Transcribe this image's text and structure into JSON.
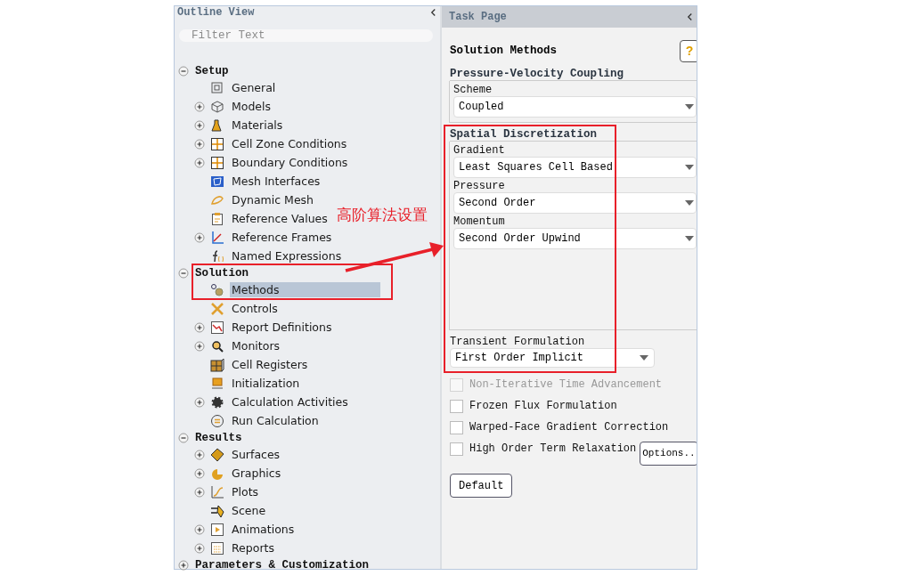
{
  "outline": {
    "title": "Outline View",
    "filter": {
      "placeholder": "Filter Text"
    },
    "sections": [
      {
        "label": "Setup",
        "expanded": true,
        "selected": false,
        "children": [
          {
            "label": "General",
            "kind": "leaf",
            "selected": false
          },
          {
            "label": "Models",
            "kind": "branch",
            "selected": false
          },
          {
            "label": "Materials",
            "kind": "branch",
            "selected": false
          },
          {
            "label": "Cell Zone Conditions",
            "kind": "branch",
            "selected": false
          },
          {
            "label": "Boundary Conditions",
            "kind": "branch",
            "selected": false
          },
          {
            "label": "Mesh Interfaces",
            "kind": "leaf",
            "selected": false
          },
          {
            "label": "Dynamic Mesh",
            "kind": "leaf",
            "selected": false
          },
          {
            "label": "Reference Values",
            "kind": "leaf",
            "selected": false
          },
          {
            "label": "Reference Frames",
            "kind": "branch",
            "selected": false
          },
          {
            "label": "Named Expressions",
            "kind": "leaf",
            "selected": false
          }
        ]
      },
      {
        "label": "Solution",
        "expanded": true,
        "selected": false,
        "children": [
          {
            "label": "Methods",
            "kind": "leaf",
            "selected": true
          },
          {
            "label": "Controls",
            "kind": "leaf",
            "selected": false
          },
          {
            "label": "Report Definitions",
            "kind": "branch",
            "selected": false
          },
          {
            "label": "Monitors",
            "kind": "branch",
            "selected": false
          },
          {
            "label": "Cell Registers",
            "kind": "leaf",
            "selected": false
          },
          {
            "label": "Initialization",
            "kind": "leaf",
            "selected": false
          },
          {
            "label": "Calculation Activities",
            "kind": "branch",
            "selected": false
          },
          {
            "label": "Run Calculation",
            "kind": "leaf",
            "selected": false
          }
        ]
      },
      {
        "label": "Results",
        "expanded": true,
        "selected": false,
        "children": [
          {
            "label": "Surfaces",
            "kind": "branch",
            "selected": false
          },
          {
            "label": "Graphics",
            "kind": "branch",
            "selected": false
          },
          {
            "label": "Plots",
            "kind": "branch",
            "selected": false
          },
          {
            "label": "Scene",
            "kind": "leaf",
            "selected": false
          },
          {
            "label": "Animations",
            "kind": "branch",
            "selected": false
          },
          {
            "label": "Reports",
            "kind": "branch",
            "selected": false
          }
        ]
      },
      {
        "label": "Parameters & Customization",
        "expanded": false,
        "selected": false
      }
    ]
  },
  "task_page": {
    "title": "Task Page",
    "heading": "Solution Methods",
    "help_button": "?",
    "coupling": {
      "title": "Pressure-Velocity Coupling",
      "fields": [
        {
          "label": "Scheme",
          "value": "Coupled"
        }
      ]
    },
    "spatial": {
      "title": "Spatial Discretization",
      "fields": [
        {
          "label": "Gradient",
          "value": "Least Squares Cell Based"
        },
        {
          "label": "Pressure",
          "value": "Second Order"
        },
        {
          "label": "Momentum",
          "value": "Second Order Upwind"
        }
      ]
    },
    "transient": {
      "label": "Transient Formulation",
      "value": "First Order Implicit"
    },
    "options": [
      {
        "label": "Non-Iterative Time Advancement",
        "checked": false,
        "disabled": true
      },
      {
        "label": "Frozen Flux Formulation",
        "checked": false,
        "disabled": false
      },
      {
        "label": "Warped-Face Gradient Correction",
        "checked": false,
        "disabled": false
      },
      {
        "label": "High Order Term Relaxation",
        "checked": false,
        "disabled": false,
        "button": "Options.."
      }
    ],
    "default_button": "Default"
  },
  "annotation": {
    "text": "高阶算法设置"
  }
}
